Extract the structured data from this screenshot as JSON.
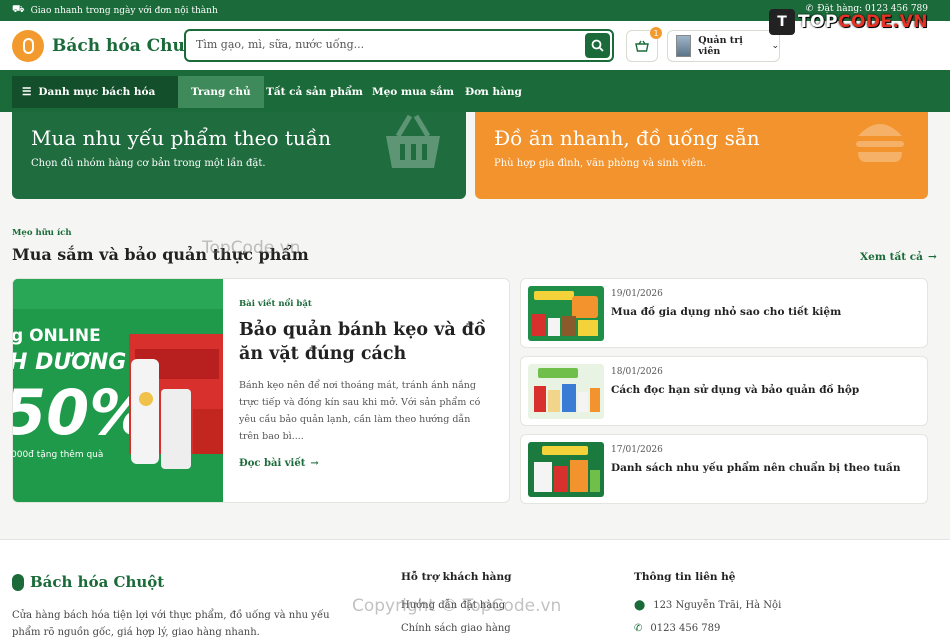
{
  "topbar": {
    "shipping_text": "Giao nhanh trong ngày với đơn nội thành",
    "hotline": "Đặt hàng: 0123 456 789"
  },
  "watermark_logo": {
    "part1": "TOP",
    "part2": "CODE.VN"
  },
  "header": {
    "brand_name": "Bách hóa Chuột",
    "search_placeholder": "Tìm gạo, mì, sữa, nước uống...",
    "cart_count": "1",
    "account_label": "Quản trị viên"
  },
  "nav": {
    "category_button": "Danh mục bách hóa",
    "items": [
      {
        "label": "Trang chủ"
      },
      {
        "label": "Tất cả sản phẩm"
      },
      {
        "label": "Mẹo mua sắm"
      },
      {
        "label": "Đơn hàng"
      }
    ]
  },
  "promos": [
    {
      "title": "Mua nhu yếu phẩm theo tuần",
      "subtitle": "Chọn đủ nhóm hàng cơ bản trong một lần đặt.",
      "color": "#1f6d3f"
    },
    {
      "title": "Đồ ăn nhanh, đồ uống sẵn",
      "subtitle": "Phù hợp gia đình, văn phòng và sinh viên.",
      "color": "#f2932d"
    }
  ],
  "section": {
    "kicker": "Mẹo hữu ích",
    "title": "Mua sắm và bảo quản thực phẩm",
    "see_all": "Xem tất cả"
  },
  "featured": {
    "kicker": "Bài viết nổi bật",
    "title": "Bảo quản bánh kẹo và đồ ăn vặt đúng cách",
    "excerpt": "Bánh kẹo nên để nơi thoáng mát, tránh ánh nắng trực tiếp và đóng kín sau khi mở. Với sản phẩm có yêu cầu bảo quản lạnh, cần làm theo hướng dẫn trên bao bì....",
    "read_more": "Đọc bài viết",
    "image_text": {
      "line1": "g ONLINE",
      "line2": "H DƯƠNG",
      "line3": "50%",
      "line4": "000đ tặng thêm quà"
    }
  },
  "articles": [
    {
      "date": "19/01/2026",
      "title": "Mua đồ gia dụng nhỏ sao cho tiết kiệm"
    },
    {
      "date": "18/01/2026",
      "title": "Cách đọc hạn sử dụng và bảo quản đồ hộp"
    },
    {
      "date": "17/01/2026",
      "title": "Danh sách nhu yếu phẩm nên chuẩn bị theo tuần"
    }
  ],
  "footer": {
    "brand_name": "Bách hóa Chuột",
    "description": "Cửa hàng bách hóa tiện lợi với thực phẩm, đồ uống và nhu yếu phẩm rõ nguồn gốc, giá hợp lý, giao hàng nhanh.",
    "support_title": "Hỗ trợ khách hàng",
    "support_links": [
      "Hướng dẫn đặt hàng",
      "Chính sách giao hàng"
    ],
    "contact_title": "Thông tin liên hệ",
    "address": "123 Nguyễn Trãi, Hà Nội",
    "phone": "0123 456 789"
  },
  "watermarks": {
    "mid": "TopCode.vn",
    "footer": "Copyright © TopCode.vn"
  },
  "colors": {
    "primary": "#1b6b3a",
    "accent": "#f2932d"
  }
}
